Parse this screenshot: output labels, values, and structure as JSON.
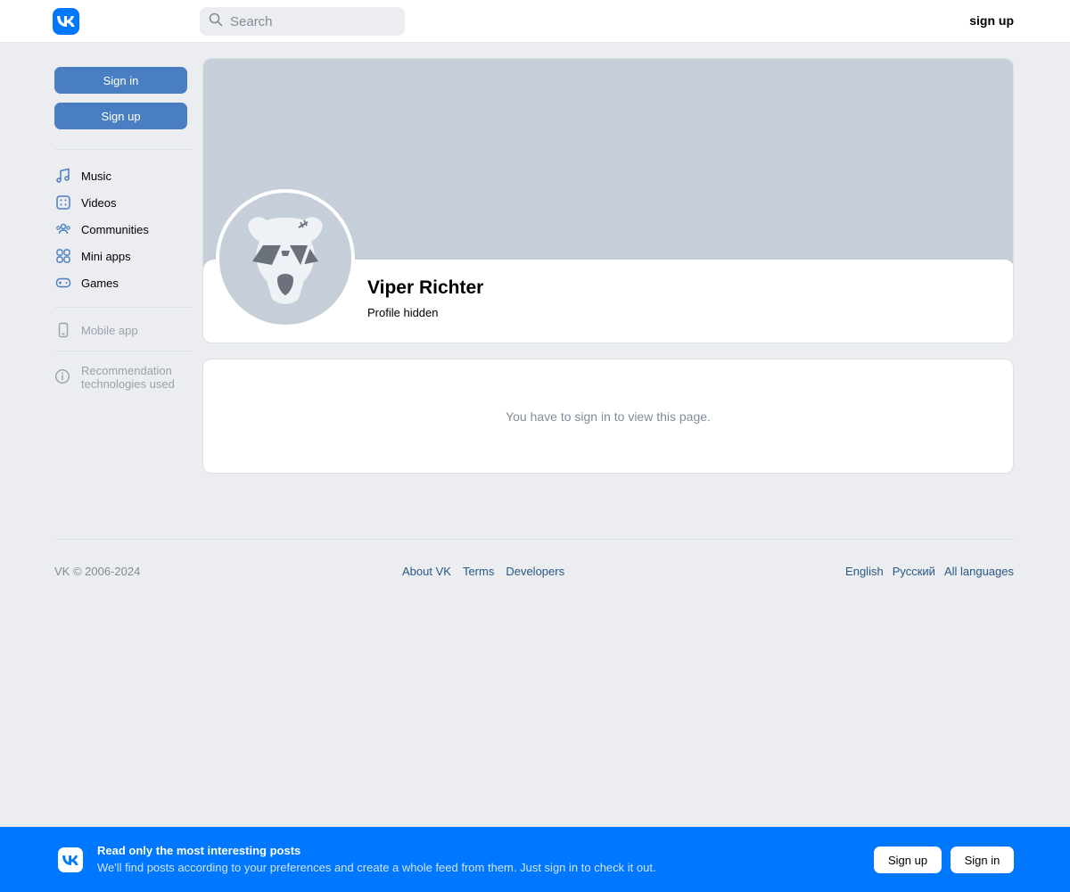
{
  "header": {
    "logo_icon": "vk-logo-icon",
    "search_placeholder": "Search",
    "signup_label": "sign up"
  },
  "sidebar": {
    "signin_label": "Sign in",
    "signup_label": "Sign up",
    "nav": [
      {
        "label": "Music",
        "icon": "music-note-icon"
      },
      {
        "label": "Videos",
        "icon": "video-icon"
      },
      {
        "label": "Communities",
        "icon": "people-icon"
      },
      {
        "label": "Mini apps",
        "icon": "grid-icon"
      },
      {
        "label": "Games",
        "icon": "gamepad-icon"
      }
    ],
    "mobile_app": "Mobile app",
    "recommendation_line1": "Recommendation",
    "recommendation_line2": "technologies used"
  },
  "profile": {
    "name": "Viper Richter",
    "status": "Profile hidden"
  },
  "locked": {
    "message": "You have to sign in to view this page."
  },
  "footer": {
    "copyright": "VK © 2006-2024",
    "links": [
      "About VK",
      "Terms",
      "Developers"
    ],
    "languages": [
      "English",
      "Русский",
      "All languages"
    ]
  },
  "banner": {
    "title": "Read only the most interesting posts",
    "subtitle": "We'll find posts according to your preferences and create a whole feed from them. Just sign in to check it out.",
    "signup_label": "Sign up",
    "signin_label": "Sign in"
  },
  "colors": {
    "accent": "#0077ff",
    "sidebar_button": "#4a7ec2",
    "link": "#2a5885",
    "background": "#ebedf0"
  }
}
